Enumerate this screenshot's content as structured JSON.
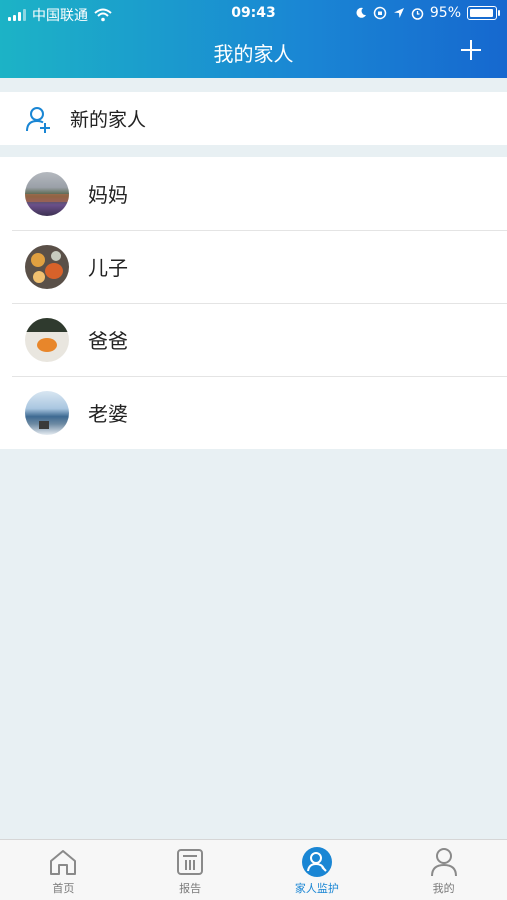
{
  "status_bar": {
    "carrier": "中国联通",
    "time": "09:43",
    "battery": "95%"
  },
  "header": {
    "title": "我的家人"
  },
  "new_family": {
    "label": "新的家人"
  },
  "family": [
    {
      "name": "妈妈"
    },
    {
      "name": "儿子"
    },
    {
      "name": "爸爸"
    },
    {
      "name": "老婆"
    }
  ],
  "tabs": [
    {
      "label": "首页",
      "icon": "home-icon"
    },
    {
      "label": "报告",
      "icon": "report-icon"
    },
    {
      "label": "家人监护",
      "icon": "family-monitor-icon"
    },
    {
      "label": "我的",
      "icon": "profile-icon"
    }
  ],
  "colors": {
    "accent": "#1a86d4",
    "header_start": "#1cb3c6",
    "header_end": "#1668cf"
  }
}
